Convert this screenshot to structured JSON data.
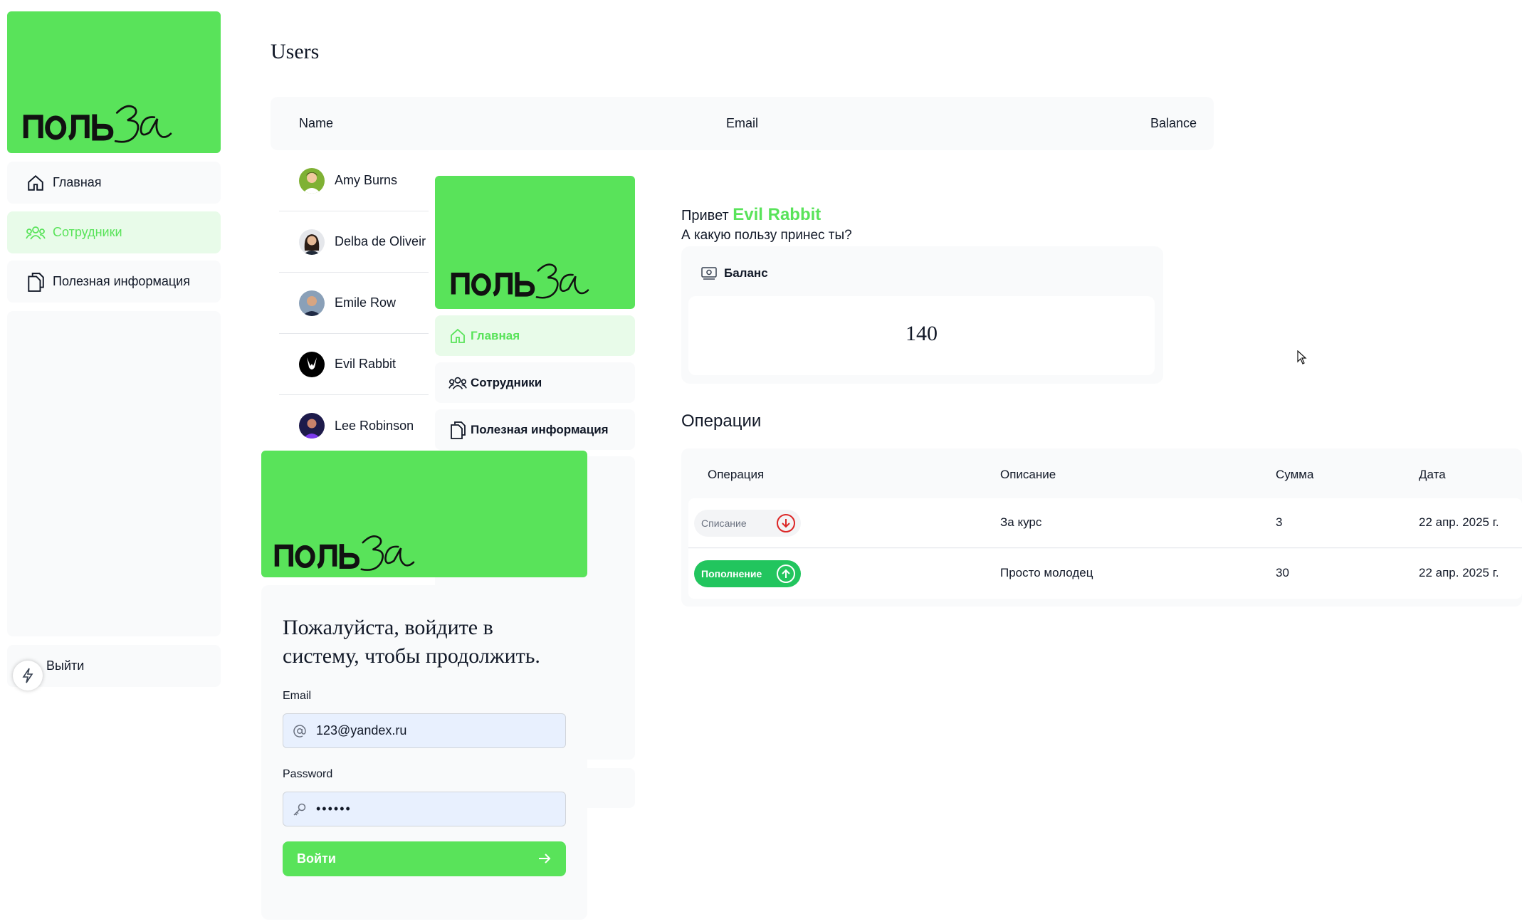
{
  "brand": {
    "logo_text": "польза",
    "color": "#59e35a"
  },
  "left_sidebar": {
    "items": [
      {
        "label": "Главная",
        "icon": "home-icon",
        "active": false
      },
      {
        "label": "Сотрудники",
        "icon": "users-icon",
        "active": true
      },
      {
        "label": "Полезная информация",
        "icon": "documents-icon",
        "active": false
      }
    ],
    "logout_label": "Выйти"
  },
  "users_page": {
    "title": "Users",
    "columns": [
      "Name",
      "Email",
      "Balance"
    ],
    "rows": [
      {
        "name": "Amy Burns"
      },
      {
        "name": "Delba de Oliveir"
      },
      {
        "name": "Emile Row"
      },
      {
        "name": "Evil Rabbit"
      },
      {
        "name": "Lee Robinson"
      }
    ]
  },
  "mid_sidebar": {
    "items": [
      {
        "label": "Главная",
        "icon": "home-icon",
        "active": true
      },
      {
        "label": "Сотрудники",
        "icon": "users-icon",
        "active": false
      },
      {
        "label": "Полезная информация",
        "icon": "documents-icon",
        "active": false
      }
    ]
  },
  "dashboard": {
    "greeting_prefix": "Привет",
    "user_name": "Evil Rabbit",
    "subtitle": "А какую пользу принес ты?",
    "balance_label": "Баланс",
    "balance_value": "140",
    "operations_title": "Операции",
    "operations_columns": [
      "Операция",
      "Описание",
      "Сумма",
      "Дата"
    ],
    "operations": [
      {
        "type": "Списание",
        "kind": "out",
        "description": "За курс",
        "amount": "3",
        "date": "22 апр. 2025 г."
      },
      {
        "type": "Пополнение",
        "kind": "in",
        "description": "Просто молодец",
        "amount": "30",
        "date": "22 апр. 2025 г."
      }
    ]
  },
  "login": {
    "heading_line1": "Пожалуйста, войдите в",
    "heading_line2": "систему, чтобы продолжить.",
    "email_label": "Email",
    "email_value": "123@yandex.ru",
    "password_label": "Password",
    "password_value": "••••••",
    "submit_label": "Войти"
  },
  "colors": {
    "accent": "#59e35a",
    "success": "#22c55e",
    "danger": "#dc2626",
    "muted_bg": "#f9fafb"
  }
}
